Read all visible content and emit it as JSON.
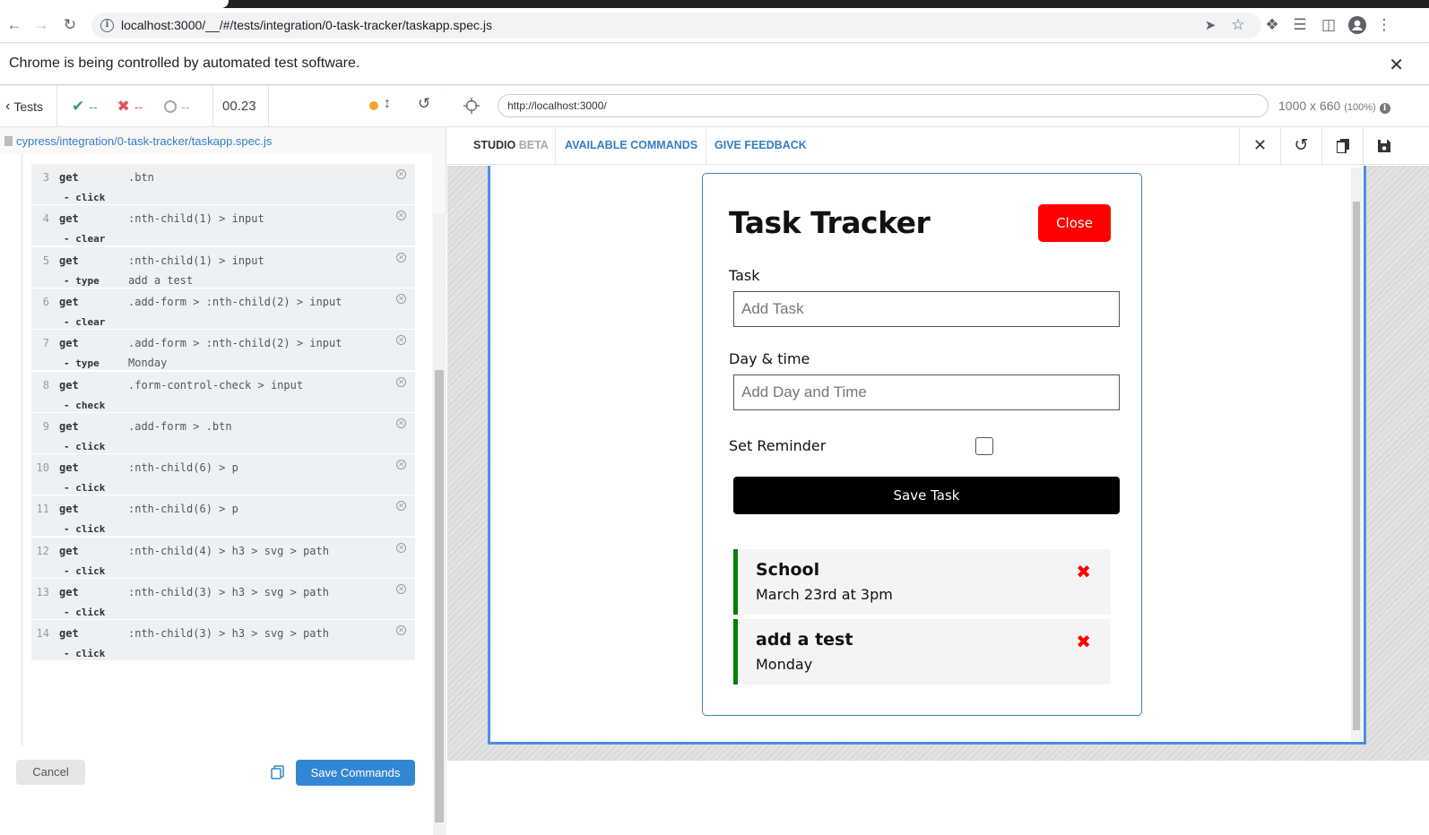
{
  "browser": {
    "url": "localhost:3000/__/#/tests/integration/0-task-tracker/taskapp.spec.js",
    "infobar_text": "Chrome is being controlled by automated test software."
  },
  "reporter": {
    "tests_label": "Tests",
    "passed": "--",
    "failed": "--",
    "pending": "--",
    "duration": "00.23",
    "spec_path": "cypress/integration/0-task-tracker/taskapp.spec.js",
    "commands": [
      {
        "num": "3",
        "name": "get",
        "arg": ".btn",
        "action": "- click",
        "action_arg": ""
      },
      {
        "num": "4",
        "name": "get",
        "arg": ":nth-child(1) > input",
        "action": "- clear",
        "action_arg": ""
      },
      {
        "num": "5",
        "name": "get",
        "arg": ":nth-child(1) > input",
        "action": "- type",
        "action_arg": "add a test"
      },
      {
        "num": "6",
        "name": "get",
        "arg": ".add-form > :nth-child(2) > input",
        "action": "- clear",
        "action_arg": ""
      },
      {
        "num": "7",
        "name": "get",
        "arg": ".add-form > :nth-child(2) > input",
        "action": "- type",
        "action_arg": "Monday"
      },
      {
        "num": "8",
        "name": "get",
        "arg": ".form-control-check > input",
        "action": "- check",
        "action_arg": ""
      },
      {
        "num": "9",
        "name": "get",
        "arg": ".add-form > .btn",
        "action": "- click",
        "action_arg": ""
      },
      {
        "num": "10",
        "name": "get",
        "arg": ":nth-child(6) > p",
        "action": "- click",
        "action_arg": ""
      },
      {
        "num": "11",
        "name": "get",
        "arg": ":nth-child(6) > p",
        "action": "- click",
        "action_arg": ""
      },
      {
        "num": "12",
        "name": "get",
        "arg": ":nth-child(4) > h3 > svg > path",
        "action": "- click",
        "action_arg": ""
      },
      {
        "num": "13",
        "name": "get",
        "arg": ":nth-child(3) > h3 > svg > path",
        "action": "- click",
        "action_arg": ""
      },
      {
        "num": "14",
        "name": "get",
        "arg": ":nth-child(3) > h3 > svg > path",
        "action": "- click",
        "action_arg": ""
      }
    ],
    "cancel_label": "Cancel",
    "save_label": "Save Commands"
  },
  "aut": {
    "url": "http://localhost:3000/",
    "size": "1000 x 660",
    "zoom": "(100%)",
    "studio_label": "STUDIO",
    "beta_label": "BETA",
    "available_commands": "AVAILABLE COMMANDS",
    "give_feedback": "GIVE FEEDBACK"
  },
  "app": {
    "title": "Task Tracker",
    "close_label": "Close",
    "task_label": "Task",
    "task_placeholder": "Add Task",
    "day_label": "Day & time",
    "day_placeholder": "Add Day and Time",
    "reminder_label": "Set Reminder",
    "save_label": "Save Task",
    "tasks": [
      {
        "text": "School",
        "day": "March 23rd at 3pm"
      },
      {
        "text": "add a test",
        "day": "Monday"
      }
    ]
  },
  "colors": {
    "accent": "#3386d4",
    "close_button": "#ff0000",
    "reminder_border": "#008000"
  }
}
